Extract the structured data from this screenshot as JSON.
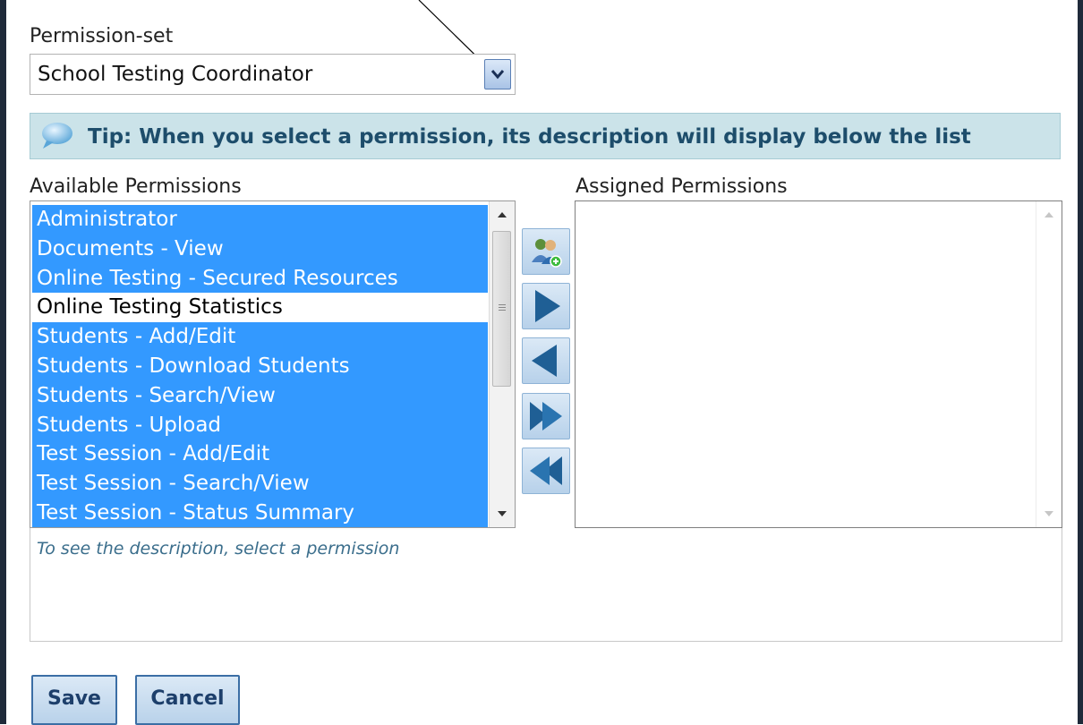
{
  "permission_set": {
    "label": "Permission-set",
    "selected": "School Testing Coordinator",
    "dropdown_icon": "chevron-down-icon"
  },
  "tip": {
    "icon": "speech-bubble-icon",
    "text": "Tip: When you select a permission, its description will display below the list"
  },
  "available": {
    "label": "Available Permissions",
    "items": [
      {
        "label": "Administrator",
        "selected": true
      },
      {
        "label": "Documents - View",
        "selected": true
      },
      {
        "label": "Online Testing - Secured Resources",
        "selected": true
      },
      {
        "label": "Online Testing Statistics",
        "selected": false
      },
      {
        "label": "Students - Add/Edit",
        "selected": true
      },
      {
        "label": "Students - Download Students",
        "selected": true
      },
      {
        "label": "Students - Search/View",
        "selected": true
      },
      {
        "label": "Students - Upload",
        "selected": true
      },
      {
        "label": "Test Session - Add/Edit",
        "selected": true
      },
      {
        "label": "Test Session - Search/View",
        "selected": true
      },
      {
        "label": "Test Session - Status Summary",
        "selected": true
      }
    ]
  },
  "assigned": {
    "label": "Assigned Permissions",
    "items": []
  },
  "transfer_buttons": [
    {
      "name": "assign-role-button",
      "icon": "users-add-icon"
    },
    {
      "name": "move-right-button",
      "icon": "arrow-right-icon"
    },
    {
      "name": "move-left-button",
      "icon": "arrow-left-icon"
    },
    {
      "name": "move-all-right-button",
      "icon": "double-arrow-right-icon"
    },
    {
      "name": "move-all-left-button",
      "icon": "double-arrow-left-icon"
    }
  ],
  "description": {
    "placeholder": "To see the description, select a permission"
  },
  "actions": {
    "save_label": "Save",
    "cancel_label": "Cancel"
  },
  "colors": {
    "selection": "#3399ff",
    "tip_background": "#cbe3e9",
    "button_border": "#3b6ea5"
  }
}
